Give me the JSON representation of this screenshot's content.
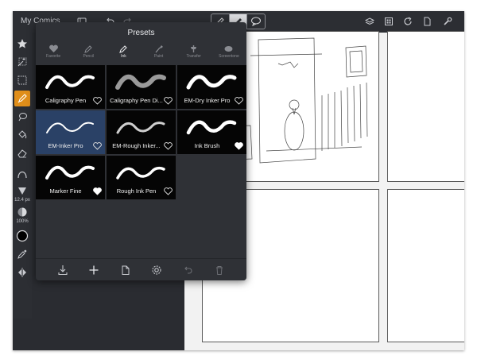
{
  "app": {
    "title": "My Comics"
  },
  "topbar": {
    "left_icons": [
      "film-icon",
      "undo-icon",
      "redo-icon"
    ],
    "tool_segments": [
      "pencil-icon",
      "eraser-icon",
      "speech-bubble-icon"
    ],
    "right_icons": [
      "layers-icon",
      "grid-icon",
      "refresh-icon",
      "page-icon",
      "wrench-icon"
    ]
  },
  "leftbar": {
    "tools": [
      "star-icon",
      "magic-select-icon",
      "rect-select-icon",
      "brush-icon",
      "lasso-fill-icon",
      "bucket-icon",
      "eraser-icon",
      "curve-icon",
      "size-icon",
      "opacity-icon",
      "color-icon",
      "eyedropper-icon",
      "mirror-icon"
    ],
    "size_label": "12.4 px",
    "opacity_label": "100%"
  },
  "presets": {
    "title": "Presets",
    "categories": [
      {
        "label": "Favorite",
        "icon": "heart-icon"
      },
      {
        "label": "Pencil",
        "icon": "pencil-icon"
      },
      {
        "label": "Ink",
        "icon": "ink-pen-icon"
      },
      {
        "label": "Paint",
        "icon": "paint-brush-icon"
      },
      {
        "label": "Transfer",
        "icon": "transfer-icon"
      },
      {
        "label": "Screentone",
        "icon": "screentone-icon"
      }
    ],
    "active_category": "Ink",
    "items": [
      {
        "name": "Caligraphy Pen",
        "favorite": false,
        "selected": false
      },
      {
        "name": "Caligraphy Pen Di...",
        "favorite": false,
        "selected": false
      },
      {
        "name": "EM-Dry Inker Pro",
        "favorite": false,
        "selected": false
      },
      {
        "name": "EM-Inker Pro",
        "favorite": false,
        "selected": true
      },
      {
        "name": "EM-Rough Inker...",
        "favorite": false,
        "selected": false
      },
      {
        "name": "Ink Brush",
        "favorite": true,
        "selected": false
      },
      {
        "name": "Marker Fine",
        "favorite": true,
        "selected": false
      },
      {
        "name": "Rough Ink Pen",
        "favorite": false,
        "selected": false
      }
    ],
    "footer": [
      "download-icon",
      "add-icon",
      "duplicate-icon",
      "settings-icon",
      "undo-icon",
      "trash-icon"
    ]
  },
  "colors": {
    "accent": "#e08e1a",
    "selected_cell": "#2a4166",
    "chrome": "#2c2e33"
  }
}
